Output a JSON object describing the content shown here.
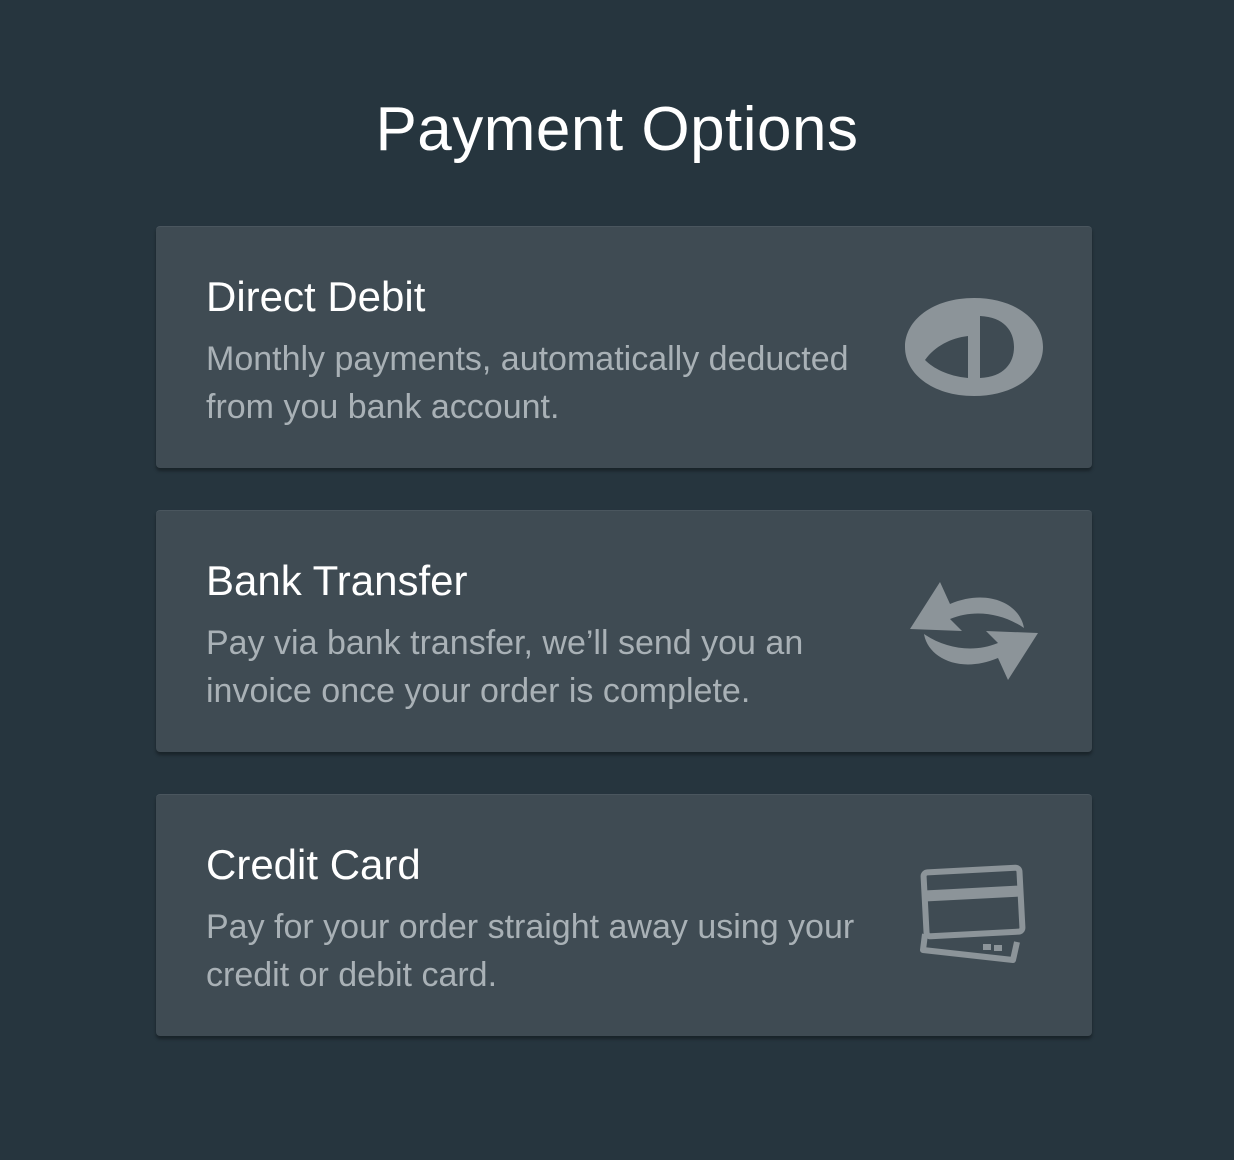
{
  "page": {
    "title": "Payment Options"
  },
  "colors": {
    "background": "#26353e",
    "card": "#3f4b53",
    "title_text": "#ffffff",
    "description_text": "#a9b1b6",
    "icon": "#8c9499"
  },
  "options": [
    {
      "title": "Direct Debit",
      "description": "Monthly payments, automatically deducted from you bank account.",
      "icon": "direct-debit-logo-icon"
    },
    {
      "title": "Bank Transfer",
      "description": "Pay via bank transfer, we’ll send you an invoice once your order is complete.",
      "icon": "transfer-arrows-icon"
    },
    {
      "title": "Credit Card",
      "description": "Pay for your order straight away using your credit or debit card.",
      "icon": "credit-card-icon"
    }
  ]
}
